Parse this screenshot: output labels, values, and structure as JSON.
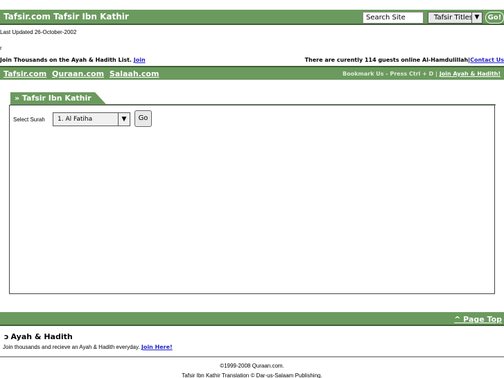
{
  "header": {
    "site_title": "Tafsir.com Tafsir Ibn Kathir",
    "search_value": "Search Site",
    "search_select_value": "Tafsir Titles",
    "go_label": "Go!"
  },
  "meta": {
    "last_updated": "Last Updated 26-October-2002",
    "stray_mark": "r"
  },
  "announce": {
    "join_text": "Join Thousands on the Ayah & Hadith List.",
    "join_link": "Join",
    "guests_text": "There are curently 114 guests online Al-Hamdulillah",
    "separator": "|",
    "contact_link": "Contact Us"
  },
  "nav": {
    "links": [
      "Tafsir.com",
      "Quraan.com",
      "Salaah.com"
    ],
    "bookmark_text": "Bookmark Us - Press Ctrl + D",
    "divider": "|",
    "join_link": "Join Ayah & Hadith!"
  },
  "main": {
    "tab_title": "» Tafsir Ibn Kathir",
    "select_label": "Select Surah",
    "select_value": "1. Al Fatiha",
    "go_label": "Go"
  },
  "footer": {
    "page_top": "^ Page Top",
    "ah_icon": "ɔ",
    "ah_title": "Ayah & Hadith",
    "join_text": "Join thousands and recieve an Ayah & Hadith everyday.",
    "join_link": "Join Here!",
    "copyright": "©1999-2008 Quraan.com.",
    "translation": "Tafsir Ibn Kathir Translation © Dar-us-Salaam Publishing."
  }
}
